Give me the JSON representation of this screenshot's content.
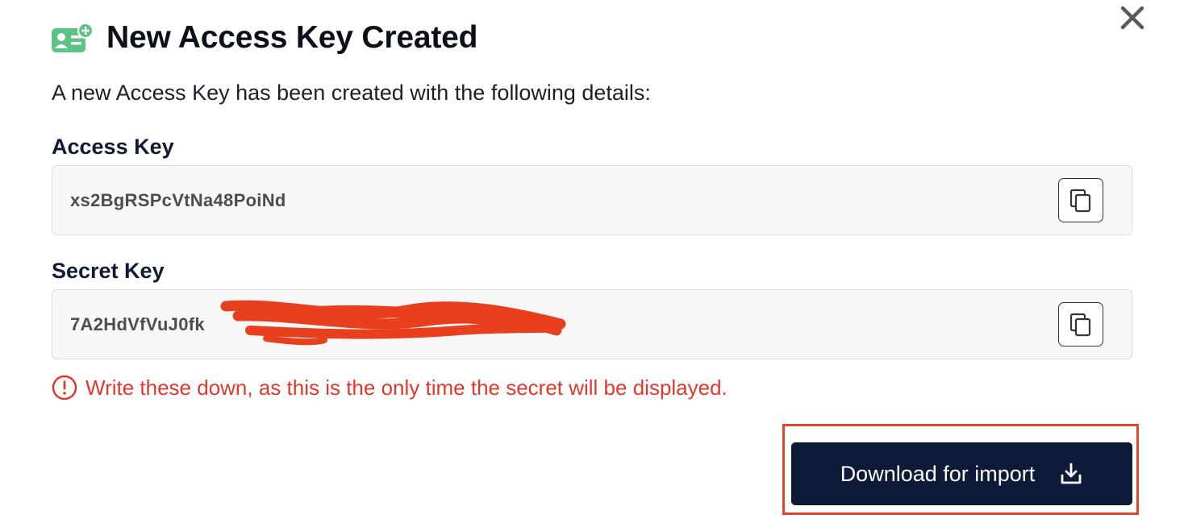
{
  "dialog": {
    "title": "New Access Key Created",
    "intro": "A new Access Key has been created with the following details:",
    "close_icon": "close-icon",
    "title_icon": "id-card-add-icon"
  },
  "access_key": {
    "label": "Access Key",
    "value": "xs2BgRSPcVtNa48PoiNd",
    "copy_icon": "copy-icon"
  },
  "secret_key": {
    "label": "Secret Key",
    "value": "7A2HdVfVuJ0fk",
    "redacted": true,
    "copy_icon": "copy-icon"
  },
  "warning": {
    "text": "Write these down, as this is the only time the secret will be displayed.",
    "icon": "alert-circle-icon",
    "color": "#e2372b"
  },
  "download_button": {
    "label": "Download for import",
    "icon": "download-icon",
    "background": "#0d1a38",
    "highlighted": true,
    "highlight_color": "#e2452f"
  },
  "colors": {
    "brand_green": "#5cc387",
    "dark_navy": "#0d1a38"
  }
}
